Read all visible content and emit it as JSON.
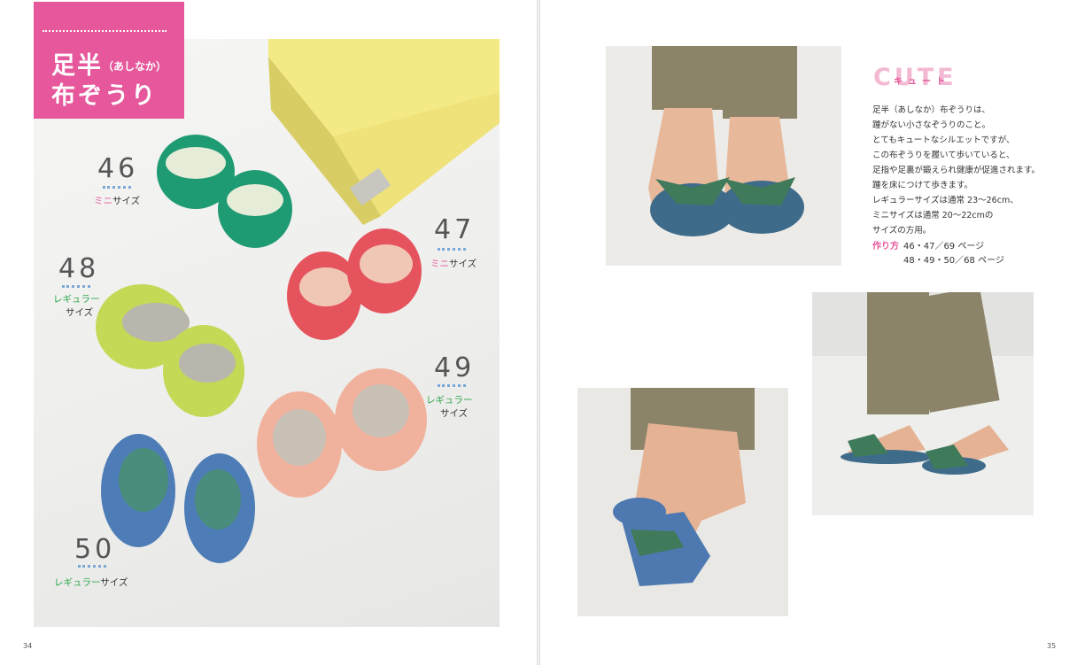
{
  "title": {
    "line1_main": "足半",
    "line1_small": "（あしなか）",
    "line2": "布ぞうり"
  },
  "items": [
    {
      "num": "46",
      "label_colored": "ミニ",
      "label_rest": "サイズ",
      "color": "#e6579b"
    },
    {
      "num": "47",
      "label_colored": "ミニ",
      "label_rest": "サイズ",
      "color": "#e6579b"
    },
    {
      "num": "48",
      "label_colored": "レギュラー",
      "label_rest": "サイズ",
      "color": "#2fa84f"
    },
    {
      "num": "49",
      "label_colored": "レギュラー",
      "label_rest": "サイズ",
      "color": "#2fa84f"
    },
    {
      "num": "50",
      "label_colored": "レギュラー",
      "label_rest": "サイズ",
      "color": "#2fa84f"
    }
  ],
  "cute": {
    "heading": "CUTE",
    "subheading": "キュート"
  },
  "body_lines": [
    "足半（あしなか）布ぞうりは、",
    "踵がない小さなぞうりのこと。",
    "とてもキュートなシルエットですが、",
    "この布ぞうりを履いて歩いていると、",
    "足指や足裏が鍛えられ健康が促進されます。",
    "踵を床につけて歩きます。",
    "レギュラーサイズは通常 23〜26cm、",
    "ミニサイズは通常 20〜22cmの",
    "サイズの方用。"
  ],
  "make": {
    "label": "作り方",
    "line1": "46・47／69 ページ",
    "line2": "48・49・50／68 ページ"
  },
  "page_left": "34",
  "page_right": "35",
  "colors": {
    "accent_pink": "#e6579b",
    "accent_green": "#2fa84f",
    "dot_blue": "#7aa7d8"
  }
}
